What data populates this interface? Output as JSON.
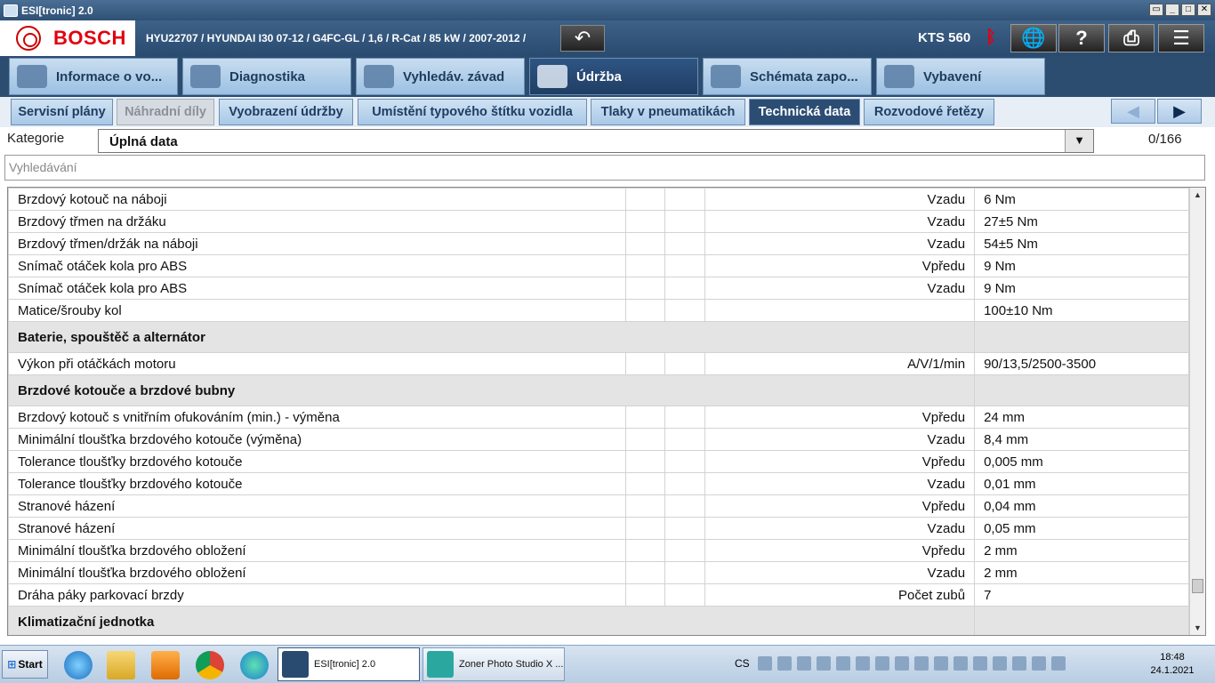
{
  "window": {
    "title": "ESI[tronic] 2.0",
    "controls": [
      "restore",
      "minimize",
      "maximize",
      "close"
    ]
  },
  "header": {
    "brand": "BOSCH",
    "vehicle": "HYU22707 / HYUNDAI I30 07-12 / G4FC-GL / 1,6 / R-Cat / 85 kW / 2007-2012 /",
    "device": "KTS 560",
    "icons": [
      "back-icon",
      "bluetooth-icon",
      "globe-network-icon",
      "help-icon",
      "print-icon",
      "menu-icon"
    ]
  },
  "tabs": [
    {
      "label": "Informace o vo...",
      "icon": "car-info-icon"
    },
    {
      "label": "Diagnostika",
      "icon": "diagnostics-icon"
    },
    {
      "label": "Vyhledáv. závad",
      "icon": "search-faults-icon"
    },
    {
      "label": "Údržba",
      "icon": "maintenance-icon",
      "active": true
    },
    {
      "label": "Schémata zapo...",
      "icon": "wiring-diagram-icon"
    },
    {
      "label": "Vybavení",
      "icon": "book-icon"
    }
  ],
  "subtabs": [
    {
      "label": "Servisní plány"
    },
    {
      "label": "Náhradní díly",
      "disabled": true
    },
    {
      "label": "Vyobrazení údržby"
    },
    {
      "label": "Umístění typového štítku vozidla"
    },
    {
      "label": "Tlaky v pneumatikách"
    },
    {
      "label": "Technická data",
      "active": true
    },
    {
      "label": "Rozvodové řetězy"
    }
  ],
  "nav": {
    "prev": "◀",
    "next": "▶"
  },
  "category": {
    "label": "Kategorie",
    "value": "Úplná data",
    "count": "0/166"
  },
  "search": {
    "placeholder": "Vyhledávání"
  },
  "rows": [
    {
      "type": "row",
      "name": "Brzdový kotouč na náboji",
      "qualifier": "Vzadu",
      "value": "6 Nm"
    },
    {
      "type": "row",
      "name": "Brzdový třmen na držáku",
      "qualifier": "Vzadu",
      "value": "27±5 Nm"
    },
    {
      "type": "row",
      "name": "Brzdový třmen/držák na náboji",
      "qualifier": "Vzadu",
      "value": "54±5 Nm"
    },
    {
      "type": "row",
      "name": "Snímač otáček kola pro ABS",
      "qualifier": "Vpředu",
      "value": "9 Nm"
    },
    {
      "type": "row",
      "name": "Snímač otáček kola pro ABS",
      "qualifier": "Vzadu",
      "value": "9 Nm"
    },
    {
      "type": "row",
      "name": "Matice/šrouby kol",
      "qualifier": "",
      "value": "100±10 Nm"
    },
    {
      "type": "section",
      "name": "Baterie, spouštěč a alternátor"
    },
    {
      "type": "row",
      "name": "Výkon při otáčkách motoru",
      "qualifier": "A/V/1/min",
      "value": "90/13,5/2500-3500"
    },
    {
      "type": "section",
      "name": "Brzdové kotouče a brzdové bubny"
    },
    {
      "type": "row",
      "name": "Brzdový kotouč s vnitřním ofukováním (min.) - výměna",
      "qualifier": "Vpředu",
      "value": "24 mm"
    },
    {
      "type": "row",
      "name": "Minimální tloušťka brzdového kotouče (výměna)",
      "qualifier": "Vzadu",
      "value": "8,4 mm"
    },
    {
      "type": "row",
      "name": "Tolerance tloušťky brzdového kotouče",
      "qualifier": "Vpředu",
      "value": "0,005 mm"
    },
    {
      "type": "row",
      "name": "Tolerance tloušťky brzdového kotouče",
      "qualifier": "Vzadu",
      "value": "0,01 mm"
    },
    {
      "type": "row",
      "name": "Stranové házení",
      "qualifier": "Vpředu",
      "value": "0,04 mm"
    },
    {
      "type": "row",
      "name": "Stranové házení",
      "qualifier": "Vzadu",
      "value": "0,05 mm"
    },
    {
      "type": "row",
      "name": "Minimální tloušťka brzdového obložení",
      "qualifier": "Vpředu",
      "value": "2 mm"
    },
    {
      "type": "row",
      "name": "Minimální tloušťka brzdového obložení",
      "qualifier": "Vzadu",
      "value": "2 mm"
    },
    {
      "type": "row",
      "name": "Dráha páky parkovací brzdy",
      "qualifier": "Počet zubů",
      "value": "7"
    },
    {
      "type": "section",
      "name": "Klimatizační jednotka"
    }
  ],
  "taskbar": {
    "start": "Start",
    "quicklaunch": [
      "internet-explorer-icon",
      "file-explorer-icon",
      "media-player-icon",
      "chrome-icon",
      "edge-icon"
    ],
    "tasks": [
      {
        "label": "ESI[tronic] 2.0",
        "active": true
      },
      {
        "label": "Zoner Photo Studio X ..."
      }
    ],
    "lang": "CS",
    "time": "18:48",
    "date": "24.1.2021"
  }
}
